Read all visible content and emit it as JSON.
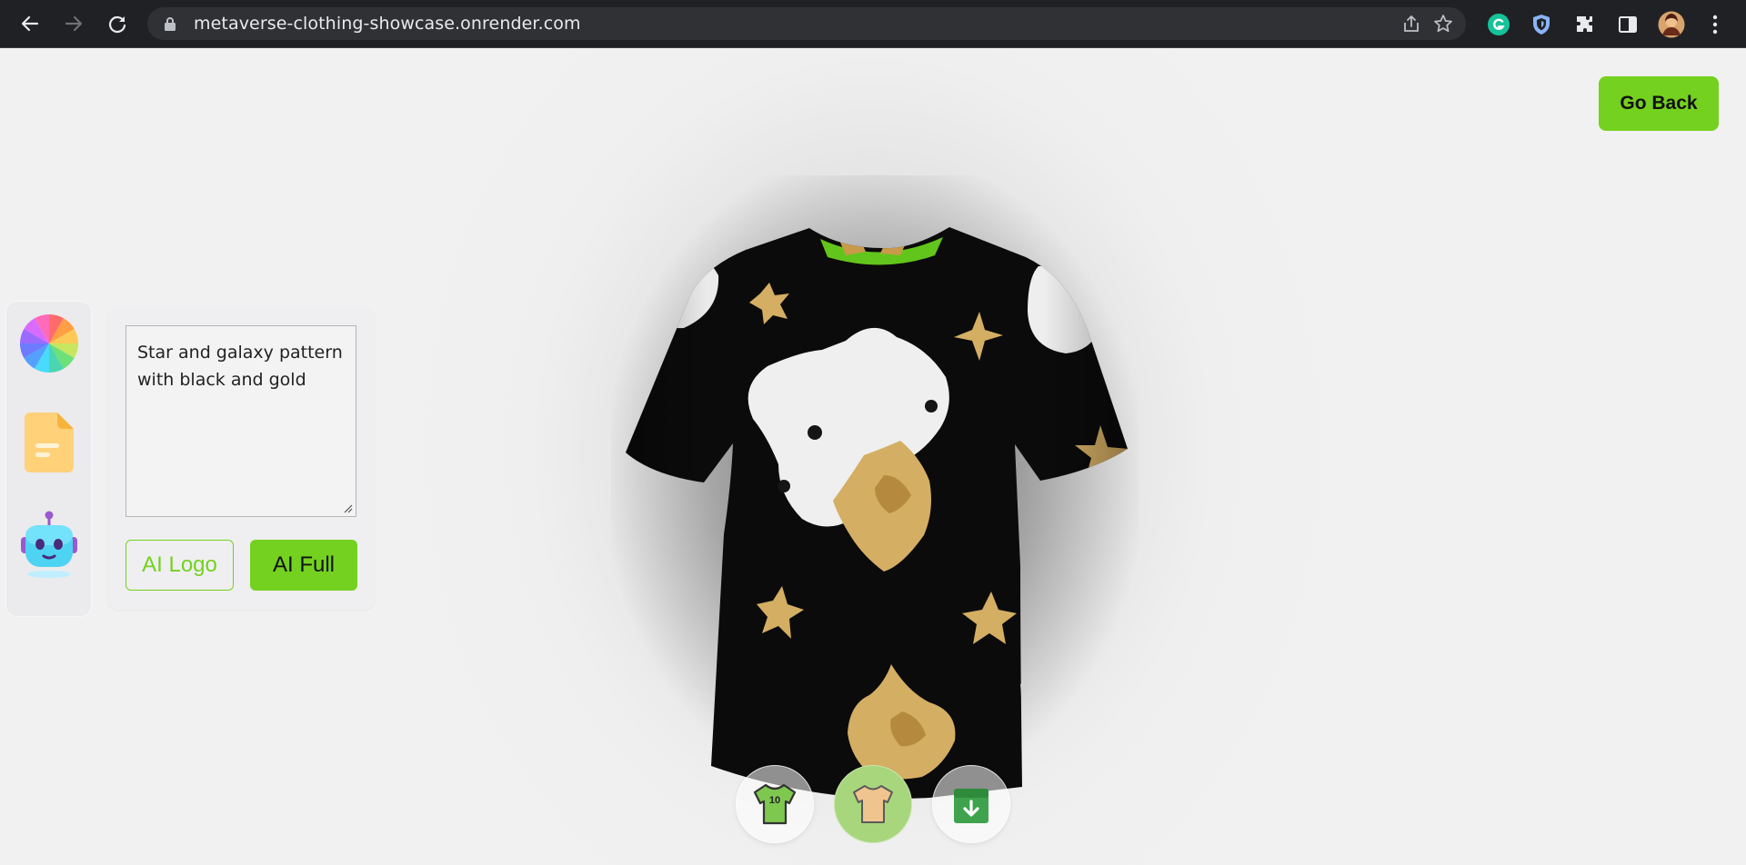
{
  "browser": {
    "url": "metaverse-clothing-showcase.onrender.com"
  },
  "icons": {
    "back": "arrow-left-icon",
    "forward": "arrow-right-icon",
    "reload": "reload-icon",
    "lock": "lock-icon",
    "share": "share-icon",
    "bookmark": "star-icon",
    "grammarly": "grammarly-icon",
    "shield": "shield-icon",
    "extensions": "puzzle-icon",
    "side_panel": "side-panel-icon",
    "profile": "avatar",
    "menu": "kebab-menu-icon"
  },
  "page": {
    "go_back_label": "Go Back",
    "tools": [
      {
        "name": "color-picker",
        "icon": "color-wheel-icon"
      },
      {
        "name": "file-picker",
        "icon": "file-icon"
      },
      {
        "name": "ai-picker",
        "icon": "robot-icon"
      }
    ],
    "ai_panel": {
      "prompt_value": "Star and galaxy pattern with black and gold",
      "ai_logo_label": "AI Logo",
      "ai_full_label": "AI Full"
    },
    "filter_tabs": [
      {
        "name": "logo-shirt",
        "icon": "jersey-icon",
        "badge": "10",
        "active": false
      },
      {
        "name": "full-texture",
        "icon": "tshirt-icon",
        "active": true
      },
      {
        "name": "download",
        "icon": "download-box-icon",
        "active": false
      }
    ]
  },
  "colors": {
    "accent": "#74d11f",
    "shirt_base": "#0b0b0b",
    "star_gold": "#d4ae63",
    "tab_active_bg": "#a7d67c"
  }
}
